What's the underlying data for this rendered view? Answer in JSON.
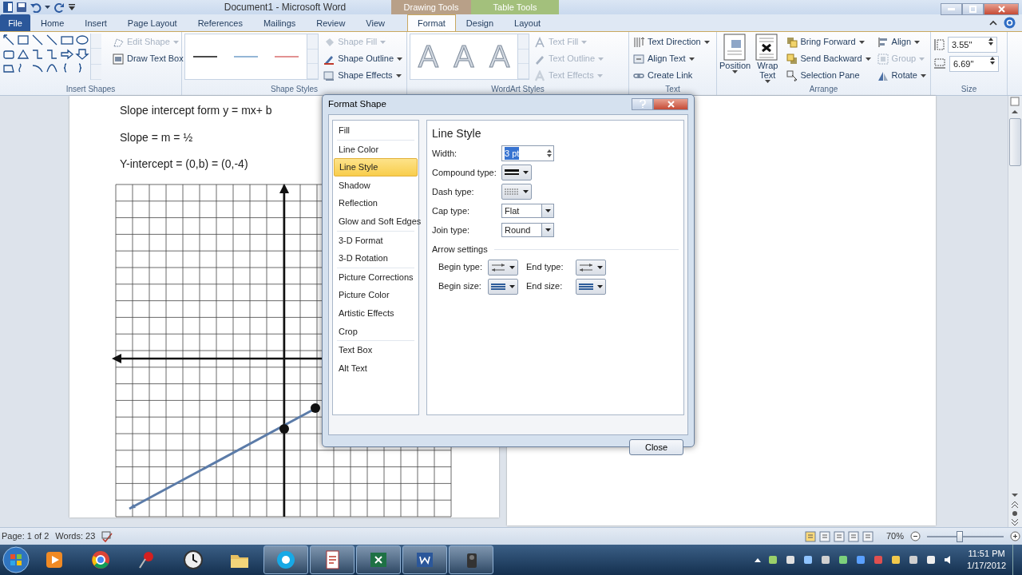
{
  "window": {
    "title": "Document1  -  Microsoft Word"
  },
  "context_tabs": [
    {
      "label": "Drawing Tools",
      "color": "#b8a088"
    },
    {
      "label": "Table Tools",
      "color": "#a3c07c"
    }
  ],
  "tabs": [
    {
      "label": "File",
      "kind": "file",
      "selected": false
    },
    {
      "label": "Home",
      "kind": "tab",
      "selected": false
    },
    {
      "label": "Insert",
      "kind": "tab",
      "selected": false
    },
    {
      "label": "Page Layout",
      "kind": "tab",
      "selected": false
    },
    {
      "label": "References",
      "kind": "tab",
      "selected": false
    },
    {
      "label": "Mailings",
      "kind": "tab",
      "selected": false
    },
    {
      "label": "Review",
      "kind": "tab",
      "selected": false
    },
    {
      "label": "View",
      "kind": "tab",
      "selected": false
    },
    {
      "label": "Format",
      "kind": "tab",
      "selected": true
    },
    {
      "label": "Design",
      "kind": "tab",
      "selected": false
    },
    {
      "label": "Layout",
      "kind": "tab",
      "selected": false
    }
  ],
  "ribbon": {
    "insert_shapes": {
      "title": "Insert Shapes",
      "commands": [
        {
          "label": "Edit Shape",
          "disabled": true
        },
        {
          "label": "Draw Text Box",
          "disabled": false
        }
      ]
    },
    "shape_styles": {
      "title": "Shape Styles",
      "styles": [
        {
          "color": "#4a4a4a"
        },
        {
          "color": "#94b6d6"
        },
        {
          "color": "#e29292"
        }
      ],
      "commands": [
        {
          "label": "Shape Fill",
          "disabled": true
        },
        {
          "label": "Shape Outline",
          "disabled": false
        },
        {
          "label": "Shape Effects",
          "disabled": false
        }
      ]
    },
    "wordart_styles": {
      "title": "WordArt Styles",
      "samples": [
        "A",
        "A",
        "A"
      ],
      "commands": [
        {
          "label": "Text Fill",
          "disabled": true
        },
        {
          "label": "Text Outline",
          "disabled": true
        },
        {
          "label": "Text Effects",
          "disabled": true
        }
      ]
    },
    "text": {
      "title": "Text",
      "commands": [
        {
          "label": "Text Direction",
          "disabled": false
        },
        {
          "label": "Align Text",
          "disabled": false
        },
        {
          "label": "Create Link",
          "disabled": false
        }
      ]
    },
    "arrange": {
      "title": "Arrange",
      "large": [
        {
          "label": "Position"
        },
        {
          "label": "Wrap Text"
        }
      ],
      "commands": [
        {
          "label": "Bring Forward",
          "disabled": false
        },
        {
          "label": "Send Backward",
          "disabled": false
        },
        {
          "label": "Selection Pane",
          "disabled": false
        },
        {
          "label": "Align",
          "disabled": false
        },
        {
          "label": "Group",
          "disabled": true
        },
        {
          "label": "Rotate",
          "disabled": false
        }
      ]
    },
    "size": {
      "title": "Size",
      "height": "3.55\"",
      "width": "6.69\""
    }
  },
  "document": {
    "lines": [
      "Slope intercept form y = mx+ b",
      "Slope = m = ½",
      "Y-intercept = (0,b) = (0,-4)"
    ]
  },
  "dialog": {
    "title": "Format Shape",
    "nav_groups": [
      [
        {
          "label": "Fill",
          "selected": false
        }
      ],
      [
        {
          "label": "Line Color",
          "selected": false
        },
        {
          "label": "Line Style",
          "selected": true
        },
        {
          "label": "Shadow",
          "selected": false
        },
        {
          "label": "Reflection",
          "selected": false
        },
        {
          "label": "Glow and Soft Edges",
          "selected": false
        }
      ],
      [
        {
          "label": "3-D Format",
          "selected": false
        },
        {
          "label": "3-D Rotation",
          "selected": false
        }
      ],
      [
        {
          "label": "Picture Corrections",
          "selected": false
        },
        {
          "label": "Picture Color",
          "selected": false
        },
        {
          "label": "Artistic Effects",
          "selected": false
        },
        {
          "label": "Crop",
          "selected": false
        }
      ],
      [
        {
          "label": "Text Box",
          "selected": false
        },
        {
          "label": "Alt Text",
          "selected": false
        }
      ]
    ],
    "heading": "Line Style",
    "fields": [
      {
        "kind": "spin",
        "label": "Width:",
        "value": "3 pt",
        "highlighted": true
      },
      {
        "kind": "compound",
        "label": "Compound type:"
      },
      {
        "kind": "dash",
        "label": "Dash type:"
      },
      {
        "kind": "combo",
        "label": "Cap type:",
        "value": "Flat"
      },
      {
        "kind": "combo",
        "label": "Join type:",
        "value": "Round"
      }
    ],
    "arrow_heading": "Arrow settings",
    "arrow_fields": [
      {
        "kind": "type",
        "label": "Begin type:"
      },
      {
        "kind": "type",
        "label": "End type:"
      },
      {
        "kind": "size",
        "label": "Begin size:"
      },
      {
        "kind": "size",
        "label": "End size:"
      }
    ],
    "close": "Close"
  },
  "status_bar": {
    "page": "Page: 1 of 2",
    "words": "Words: 23",
    "zoom": "70%",
    "zoom_slider": {
      "level": 0.42
    }
  },
  "taskbar": {
    "time": "11:51 PM",
    "date": "1/17/2012"
  }
}
